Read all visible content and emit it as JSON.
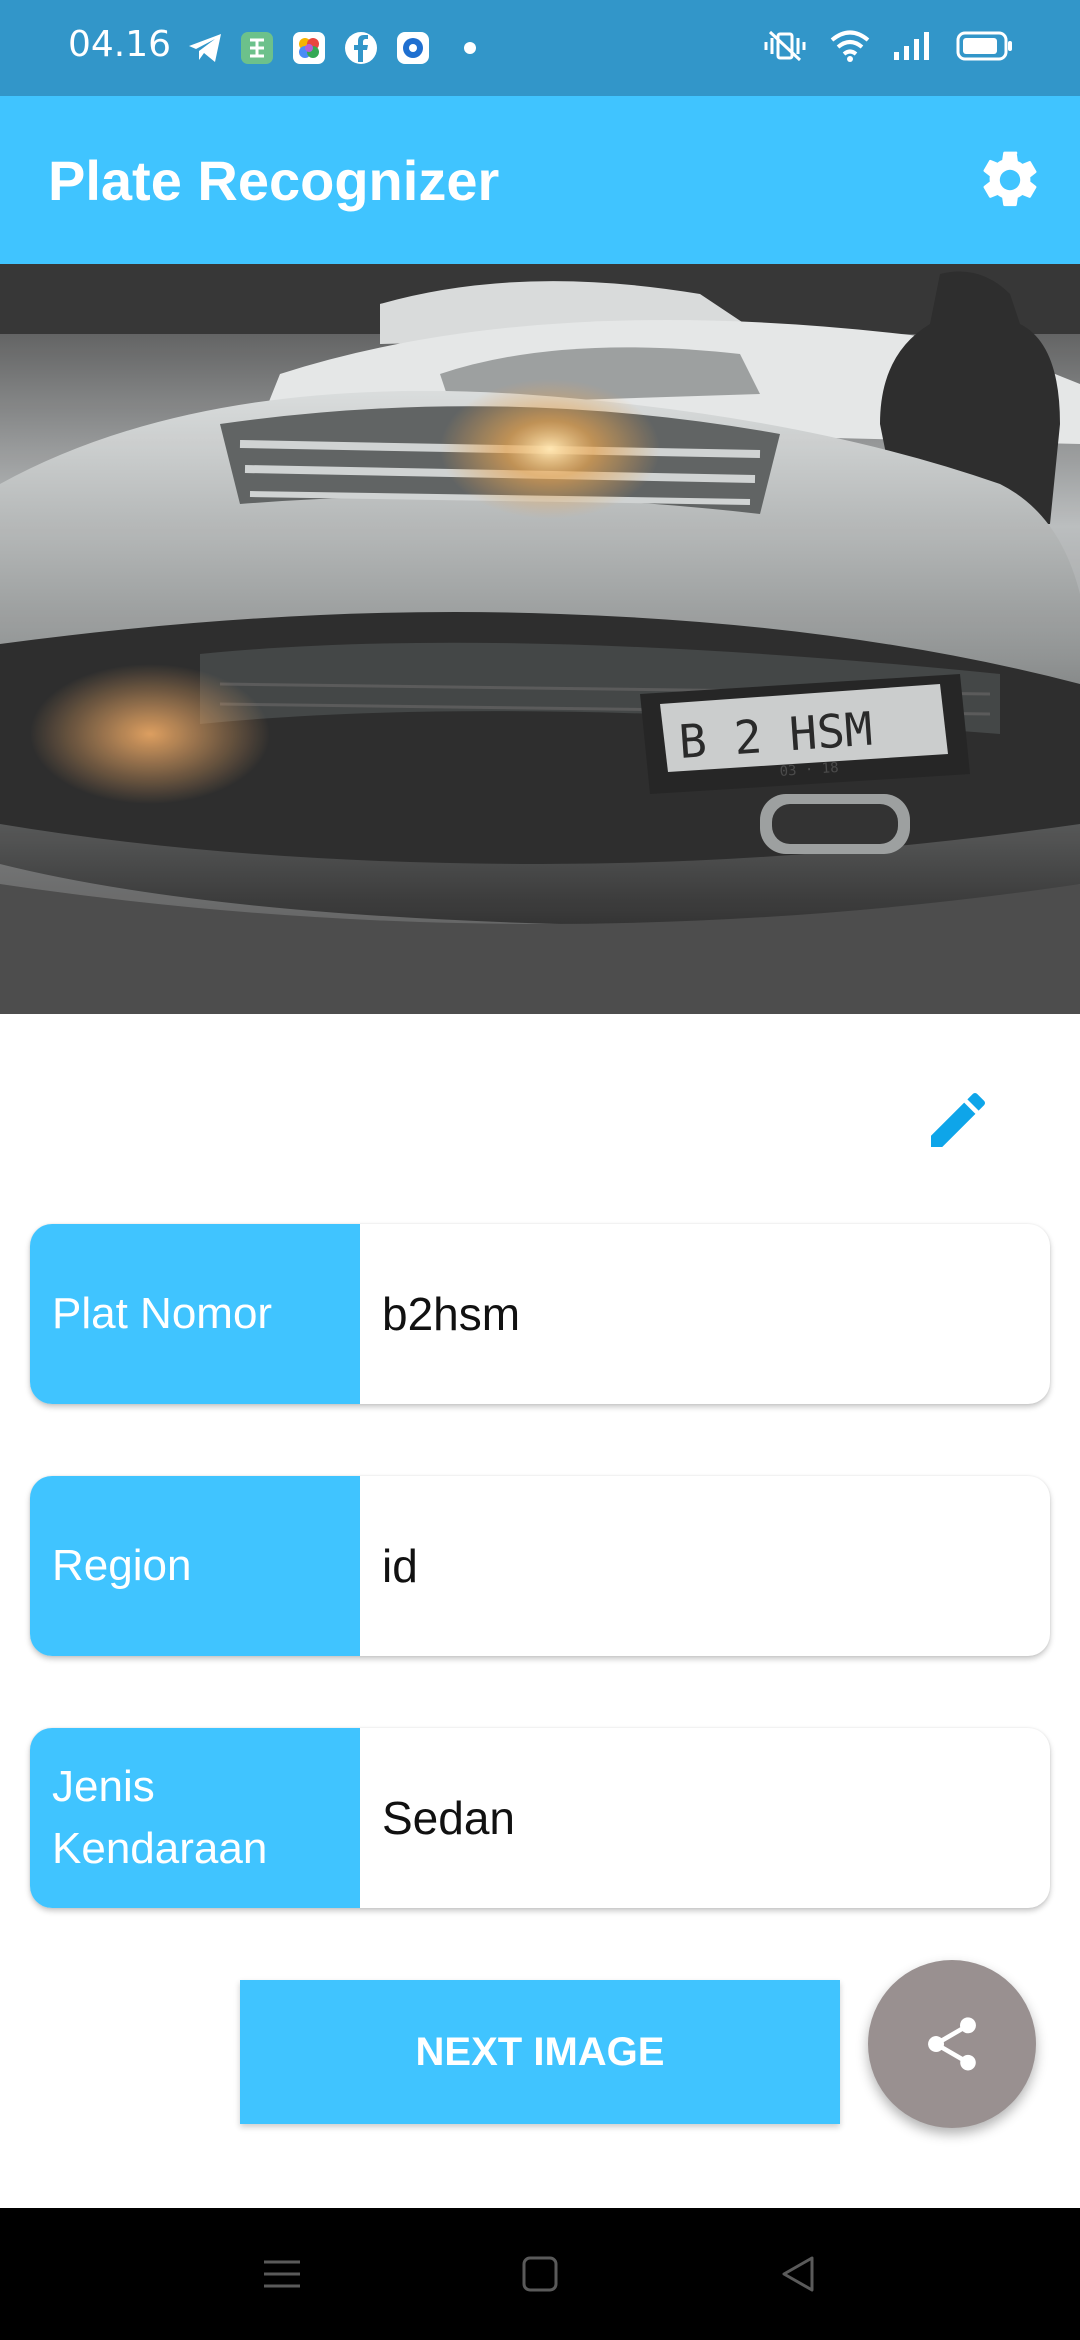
{
  "status_bar": {
    "time": "04.16",
    "left_icons": [
      "telegram-icon",
      "app-icon",
      "photos-icon",
      "facebook-icon",
      "browser-icon"
    ],
    "right_icons": [
      "vibrate-icon",
      "wifi-icon",
      "signal-icon",
      "battery-icon"
    ],
    "background_color": "#3296c9"
  },
  "app_bar": {
    "title": "Plate Recognizer",
    "settings_icon": "gear-icon",
    "background_color": "#40c4ff"
  },
  "photo": {
    "plate_text": "B 2 HSM",
    "plate_subtext": "03 · 18"
  },
  "fields": [
    {
      "label": "Plat Nomor",
      "value": "b2hsm"
    },
    {
      "label": "Region",
      "value": "id"
    },
    {
      "label": "Jenis Kendaraan",
      "value": "Sedan"
    }
  ],
  "actions": {
    "edit_icon": "pencil-icon",
    "next_label": "NEXT IMAGE",
    "share_icon": "share-icon"
  },
  "nav_bar": {
    "icons": [
      "menu-icon",
      "home-icon",
      "back-icon"
    ]
  }
}
